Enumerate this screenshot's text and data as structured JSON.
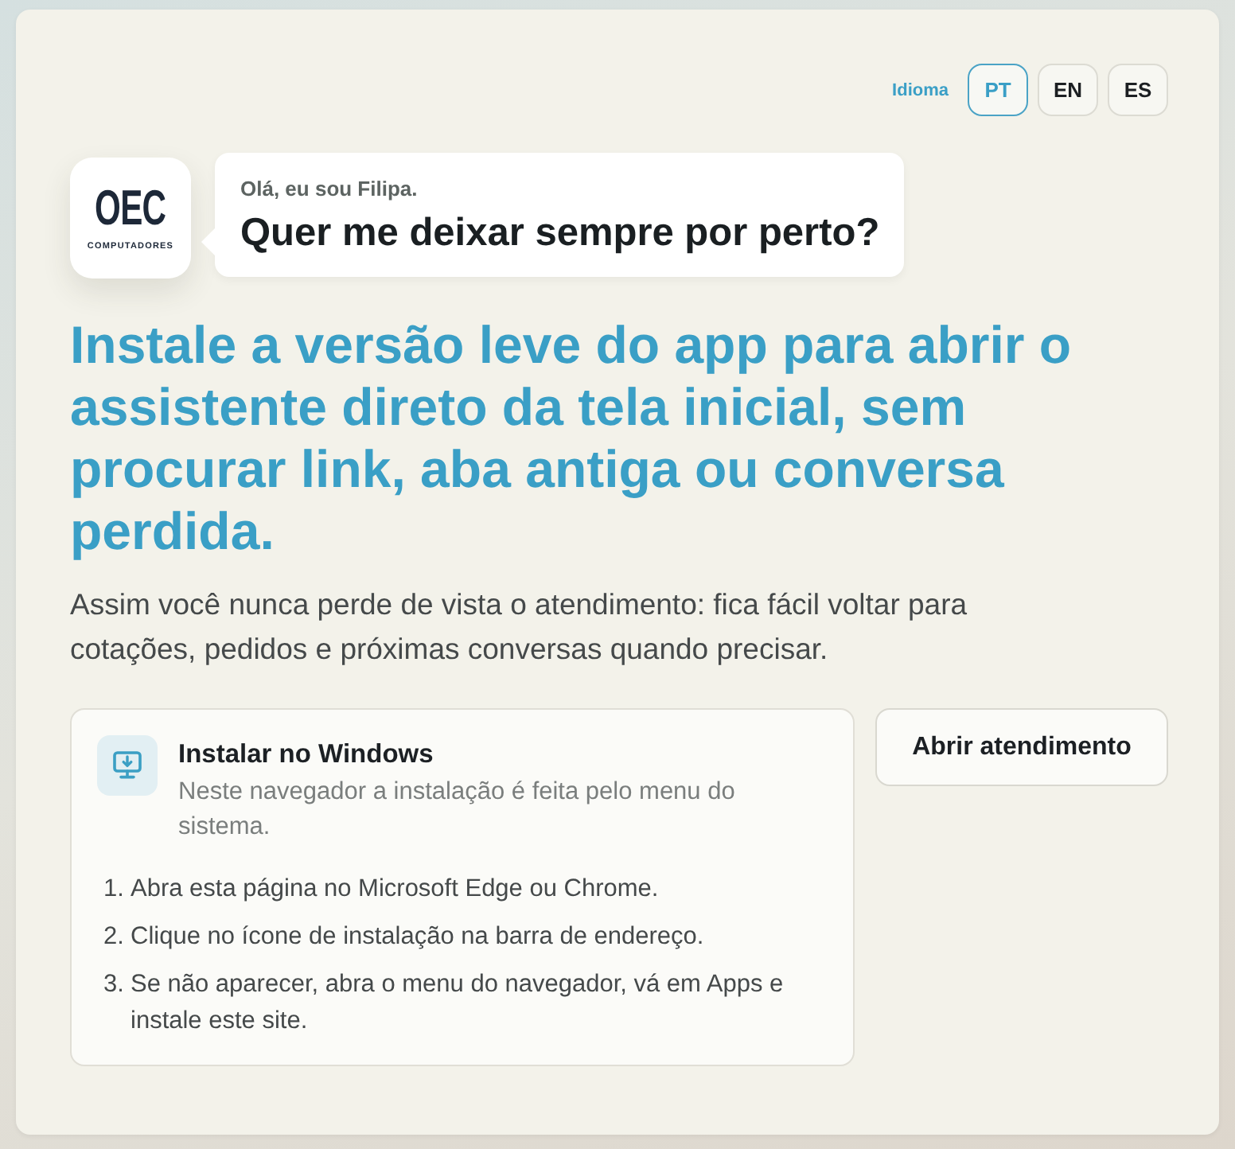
{
  "language": {
    "label": "Idioma",
    "options": [
      {
        "code": "PT",
        "selected": true
      },
      {
        "code": "EN",
        "selected": false
      },
      {
        "code": "ES",
        "selected": false
      }
    ]
  },
  "logo": {
    "name": "OEC",
    "tagline": "COMPUTADORES"
  },
  "greeting": {
    "intro": "Olá, eu sou Filipa.",
    "question": "Quer me deixar sempre por perto?"
  },
  "headline": "Instale a versão leve do app para abrir o assistente direto da tela inicial, sem procurar link, aba antiga ou conversa perdida.",
  "description": "Assim você nunca perde de vista o atendimento: fica fácil voltar para cotações, pedidos e próximas conversas quando precisar.",
  "install_card": {
    "title": "Instalar no Windows",
    "subtitle": "Neste navegador a instalação é feita pelo menu do sistema.",
    "steps": [
      {
        "number": "1.",
        "text": "Abra esta página no Microsoft Edge ou Chrome."
      },
      {
        "number": "2.",
        "text": "Clique no ícone de instalação na barra de endereço."
      },
      {
        "number": "3.",
        "text": "Se não aparecer, abra o menu do navegador, vá em Apps e instale este site."
      }
    ]
  },
  "action_button": "Abrir atendimento"
}
